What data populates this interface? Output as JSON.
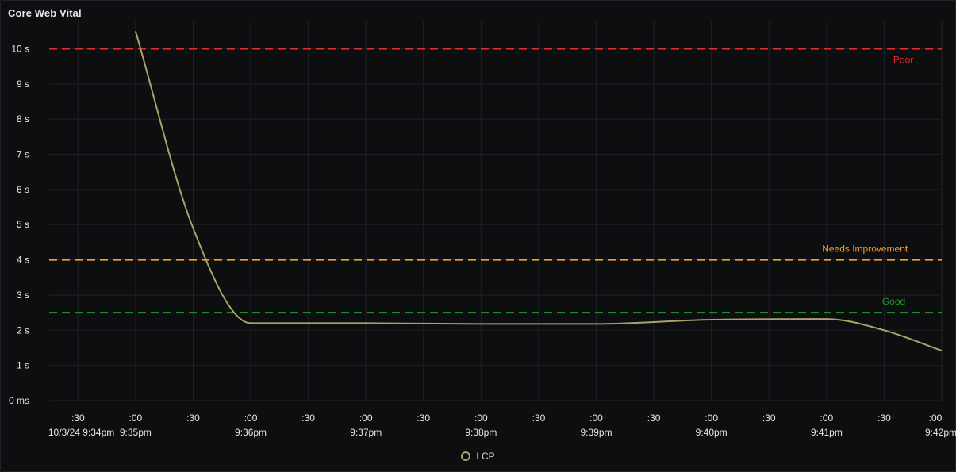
{
  "panel": {
    "title": "Core Web Vital"
  },
  "colors": {
    "series": "#a7a36a",
    "poor": "#e02f2f",
    "needs_improvement": "#f2a12c",
    "good": "#1f9e2c",
    "grid": "#1f2125",
    "tick_text": "#e6e7e8"
  },
  "chart_data": {
    "type": "line",
    "title": "Core Web Vital",
    "xlabel": "",
    "ylabel": "",
    "x_range": [
      "9:34:15pm",
      "9:42:00pm"
    ],
    "ylim": [
      0,
      10.8
    ],
    "grid": true,
    "legend_placement": "bottom-center",
    "y_ticks": [
      {
        "value": 0,
        "label": "0 ms"
      },
      {
        "value": 1,
        "label": "1 s"
      },
      {
        "value": 2,
        "label": "2 s"
      },
      {
        "value": 3,
        "label": "3 s"
      },
      {
        "value": 4,
        "label": "4 s"
      },
      {
        "value": 5,
        "label": "5 s"
      },
      {
        "value": 6,
        "label": "6 s"
      },
      {
        "value": 7,
        "label": "7 s"
      },
      {
        "value": 8,
        "label": "8 s"
      },
      {
        "value": 9,
        "label": "9 s"
      },
      {
        "value": 10,
        "label": "10 s"
      }
    ],
    "x_ticks": [
      {
        "t": "9:34:30",
        "label": ":30",
        "sublabel": "10/3/24 9:34pm"
      },
      {
        "t": "9:35:00",
        "label": ":00",
        "sublabel": "9:35pm"
      },
      {
        "t": "9:35:30",
        "label": ":30",
        "sublabel": ""
      },
      {
        "t": "9:36:00",
        "label": ":00",
        "sublabel": "9:36pm"
      },
      {
        "t": "9:36:30",
        "label": ":30",
        "sublabel": ""
      },
      {
        "t": "9:37:00",
        "label": ":00",
        "sublabel": "9:37pm"
      },
      {
        "t": "9:37:30",
        "label": ":30",
        "sublabel": ""
      },
      {
        "t": "9:38:00",
        "label": ":00",
        "sublabel": "9:38pm"
      },
      {
        "t": "9:38:30",
        "label": ":30",
        "sublabel": ""
      },
      {
        "t": "9:39:00",
        "label": ":00",
        "sublabel": "9:39pm"
      },
      {
        "t": "9:39:30",
        "label": ":30",
        "sublabel": ""
      },
      {
        "t": "9:40:00",
        "label": ":00",
        "sublabel": "9:40pm"
      },
      {
        "t": "9:40:30",
        "label": ":30",
        "sublabel": ""
      },
      {
        "t": "9:41:00",
        "label": ":00",
        "sublabel": "9:41pm"
      },
      {
        "t": "9:41:30",
        "label": ":30",
        "sublabel": ""
      },
      {
        "t": "9:42:00",
        "label": ":00",
        "sublabel": "9:42pm"
      }
    ],
    "thresholds": [
      {
        "name": "Poor",
        "value": 10,
        "color": "#e02f2f",
        "label_time": "9:41:40"
      },
      {
        "name": "Needs Improvement",
        "value": 4,
        "color": "#f2a12c",
        "label_time": "9:41:20"
      },
      {
        "name": "Good",
        "value": 2.5,
        "color": "#1f9e2c",
        "label_time": "9:41:35"
      }
    ],
    "series": [
      {
        "name": "LCP",
        "color": "#a7a36a",
        "points": [
          {
            "t": "9:35:00",
            "value": 10.5
          },
          {
            "t": "9:35:30",
            "value": 4.9
          },
          {
            "t": "9:36:00",
            "value": 2.2
          },
          {
            "t": "9:37:00",
            "value": 2.2
          },
          {
            "t": "9:38:00",
            "value": 2.18
          },
          {
            "t": "9:39:00",
            "value": 2.18
          },
          {
            "t": "9:40:00",
            "value": 2.3
          },
          {
            "t": "9:41:00",
            "value": 2.32
          },
          {
            "t": "9:41:30",
            "value": 2.0
          },
          {
            "t": "9:42:00",
            "value": 1.42
          }
        ]
      }
    ]
  },
  "legend": {
    "items": [
      {
        "label": "LCP",
        "color": "#a7a36a"
      }
    ]
  }
}
